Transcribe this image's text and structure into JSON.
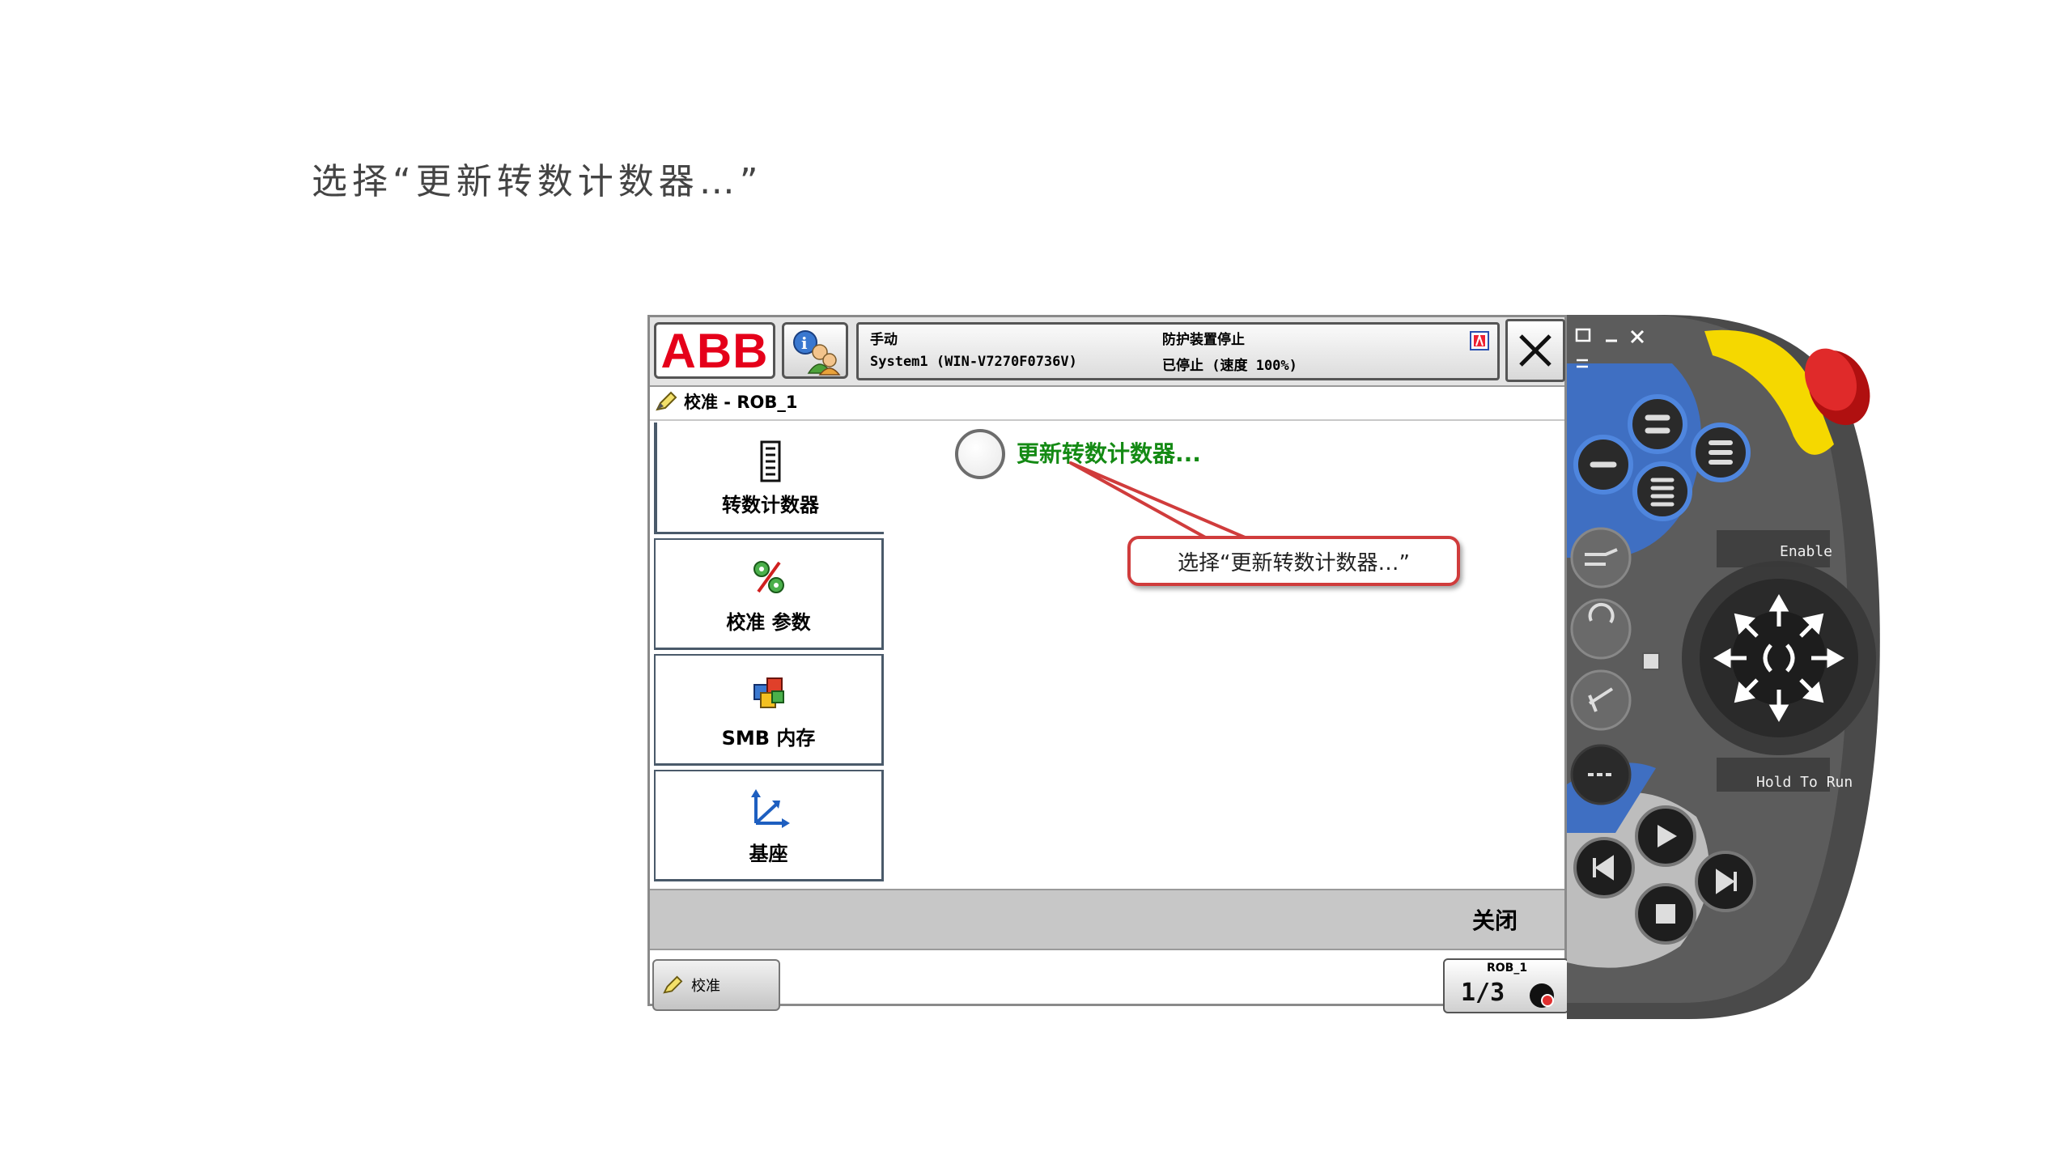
{
  "slide": {
    "instruction": "选择“更新转数计数器…”"
  },
  "topbar": {
    "logo_text": "ABB",
    "mode": "手动",
    "system": "System1 (WIN-V7270F0736V)",
    "guard_status": "防护装置停止",
    "run_status": "已停止 (速度 100%)"
  },
  "breadcrumb": {
    "text": "校准 - ROB_1"
  },
  "menu": {
    "items": [
      {
        "label": "转数计数器",
        "icon": "revolution-counter-icon"
      },
      {
        "label": "校准 参数",
        "icon": "calibration-parameters-icon"
      },
      {
        "label": "SMB 内存",
        "icon": "smb-memory-icon"
      },
      {
        "label": "基座",
        "icon": "base-frame-icon"
      }
    ]
  },
  "main": {
    "option_label": "更新转数计数器..."
  },
  "callout": {
    "text": "选择“更新转数计数器…”",
    "border_color": "#d03c3c"
  },
  "action_bar": {
    "close_label": "关闭"
  },
  "taskbar": {
    "task_label": "校准",
    "quickset_label": "ROB_1"
  },
  "pendant": {
    "enable_label": "Enable",
    "hold_label": "Hold To Run"
  },
  "colors": {
    "abb_red": "#e5001a",
    "option_green": "#148a14",
    "pendant_blue": "#3f6fc2",
    "estop_red": "#d81e1e",
    "estop_yellow": "#f5d800"
  }
}
